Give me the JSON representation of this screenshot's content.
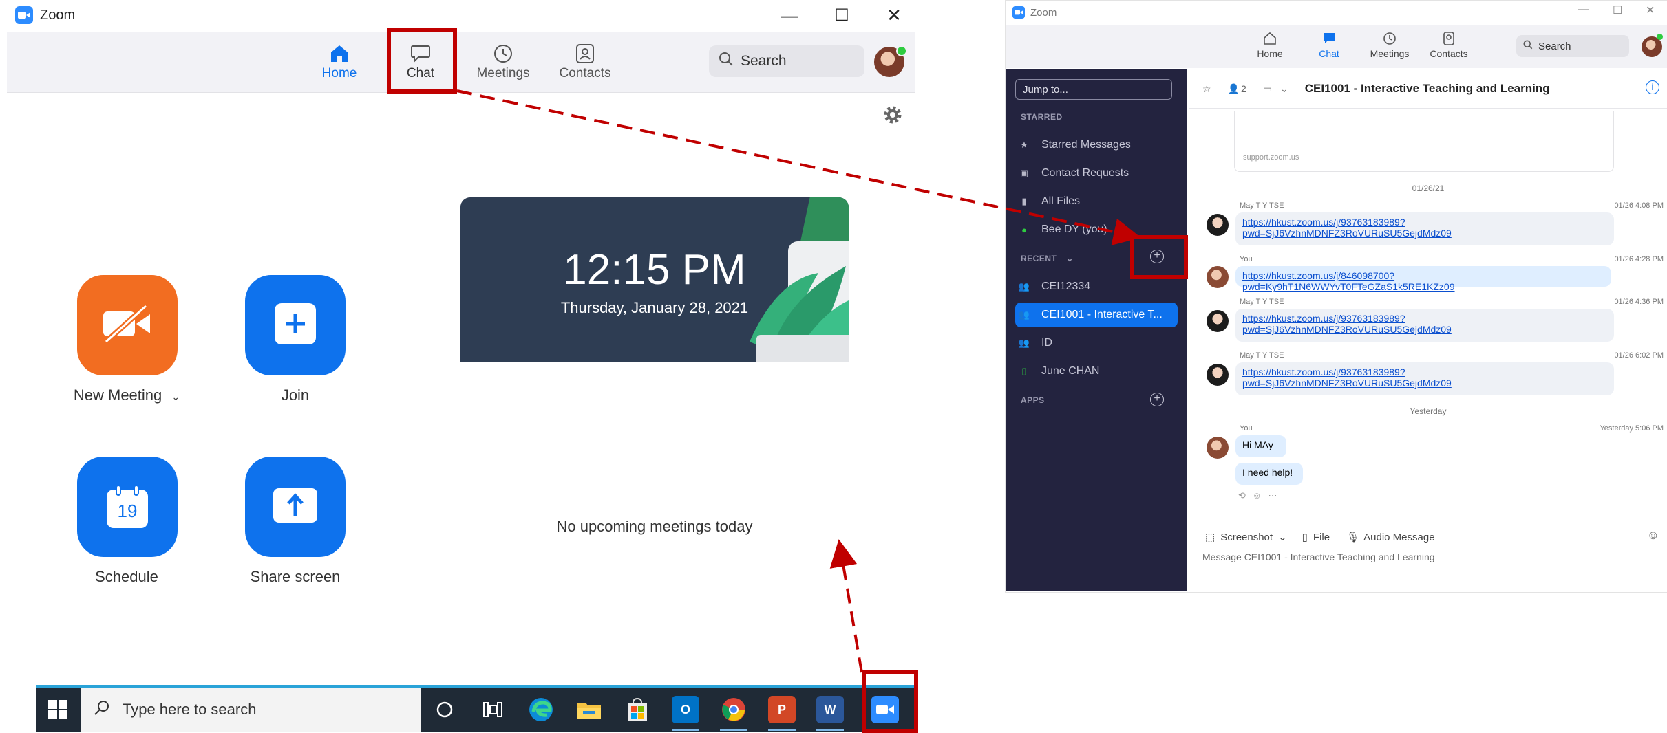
{
  "left_window": {
    "title": "Zoom",
    "controls": {
      "minimize": "—",
      "maximize": "☐",
      "close": "✕"
    },
    "tabs": [
      {
        "label": "Home",
        "icon": "home-icon"
      },
      {
        "label": "Chat",
        "icon": "chat-icon"
      },
      {
        "label": "Meetings",
        "icon": "clock-icon"
      },
      {
        "label": "Contacts",
        "icon": "contacts-icon"
      }
    ],
    "search": "Search",
    "actions": {
      "new_meeting": "New Meeting",
      "join": "Join",
      "schedule": "Schedule",
      "schedule_day": "19",
      "share_screen": "Share screen"
    },
    "clock": {
      "time": "12:15 PM",
      "date": "Thursday, January 28, 2021"
    },
    "no_meetings": "No upcoming meetings today",
    "colors": {
      "accent": "#0e72ed",
      "orange": "#f26d21",
      "annotation": "#c00000"
    }
  },
  "taskbar": {
    "search_placeholder": "Type here to search",
    "apps": [
      "cortana-icon",
      "task-view-icon",
      "edge-icon",
      "file-explorer-icon",
      "store-icon",
      "outlook-icon",
      "chrome-icon",
      "powerpoint-icon",
      "word-icon",
      "zoom-icon"
    ],
    "outlook_letter": "O",
    "powerpoint_letter": "P",
    "word_letter": "W"
  },
  "right_window": {
    "title": "Zoom",
    "tabs": [
      {
        "label": "Home"
      },
      {
        "label": "Chat"
      },
      {
        "label": "Meetings"
      },
      {
        "label": "Contacts"
      }
    ],
    "search": "Search",
    "jump_to": "Jump to...",
    "sidebar": {
      "starred_heading": "STARRED",
      "starred": [
        "Starred Messages",
        "Contact Requests",
        "All Files",
        "Bee DY (you)"
      ],
      "recent_heading": "RECENT",
      "recent": [
        "CEI12334",
        "CEI1001 - Interactive T...",
        "ID",
        "June CHAN"
      ],
      "apps_heading": "APPS"
    },
    "chat_header": {
      "members": "2",
      "title": "CEI1001 - Interactive Teaching and Learning"
    },
    "preview_link": "support.zoom.us",
    "date_divider_1": "01/26/21",
    "date_divider_2": "Yesterday",
    "messages": [
      {
        "sender": "May T Y TSE",
        "time": "01/26 4:08 PM",
        "line1": "https://hkust.zoom.us/j/93763183989?",
        "line2": "pwd=SjJ6VzhnMDNFZ3RoVURuSU5GejdMdz09"
      },
      {
        "sender": "You",
        "time": "01/26 4:28 PM",
        "line1": "https://hkust.zoom.us/j/846098700?pwd=Ky9hT1N6WWYvT0FTeGZaS1k5RE1KZz09"
      },
      {
        "sender": "May T Y TSE",
        "time": "01/26 4:36 PM",
        "line1": "https://hkust.zoom.us/j/93763183989?",
        "line2": "pwd=SjJ6VzhnMDNFZ3RoVURuSU5GejdMdz09"
      },
      {
        "sender": "May T Y TSE",
        "time": "01/26 6:02 PM",
        "line1": "https://hkust.zoom.us/j/93763183989?",
        "line2": "pwd=SjJ6VzhnMDNFZ3RoVURuSU5GejdMdz09"
      },
      {
        "sender": "You",
        "time": "Yesterday 5:06 PM",
        "line1": "Hi MAy",
        "line2": "I need help!"
      }
    ],
    "composer": {
      "screenshot": "Screenshot",
      "file": "File",
      "audio": "Audio Message",
      "placeholder": "Message CEI1001 - Interactive Teaching and Learning"
    }
  }
}
